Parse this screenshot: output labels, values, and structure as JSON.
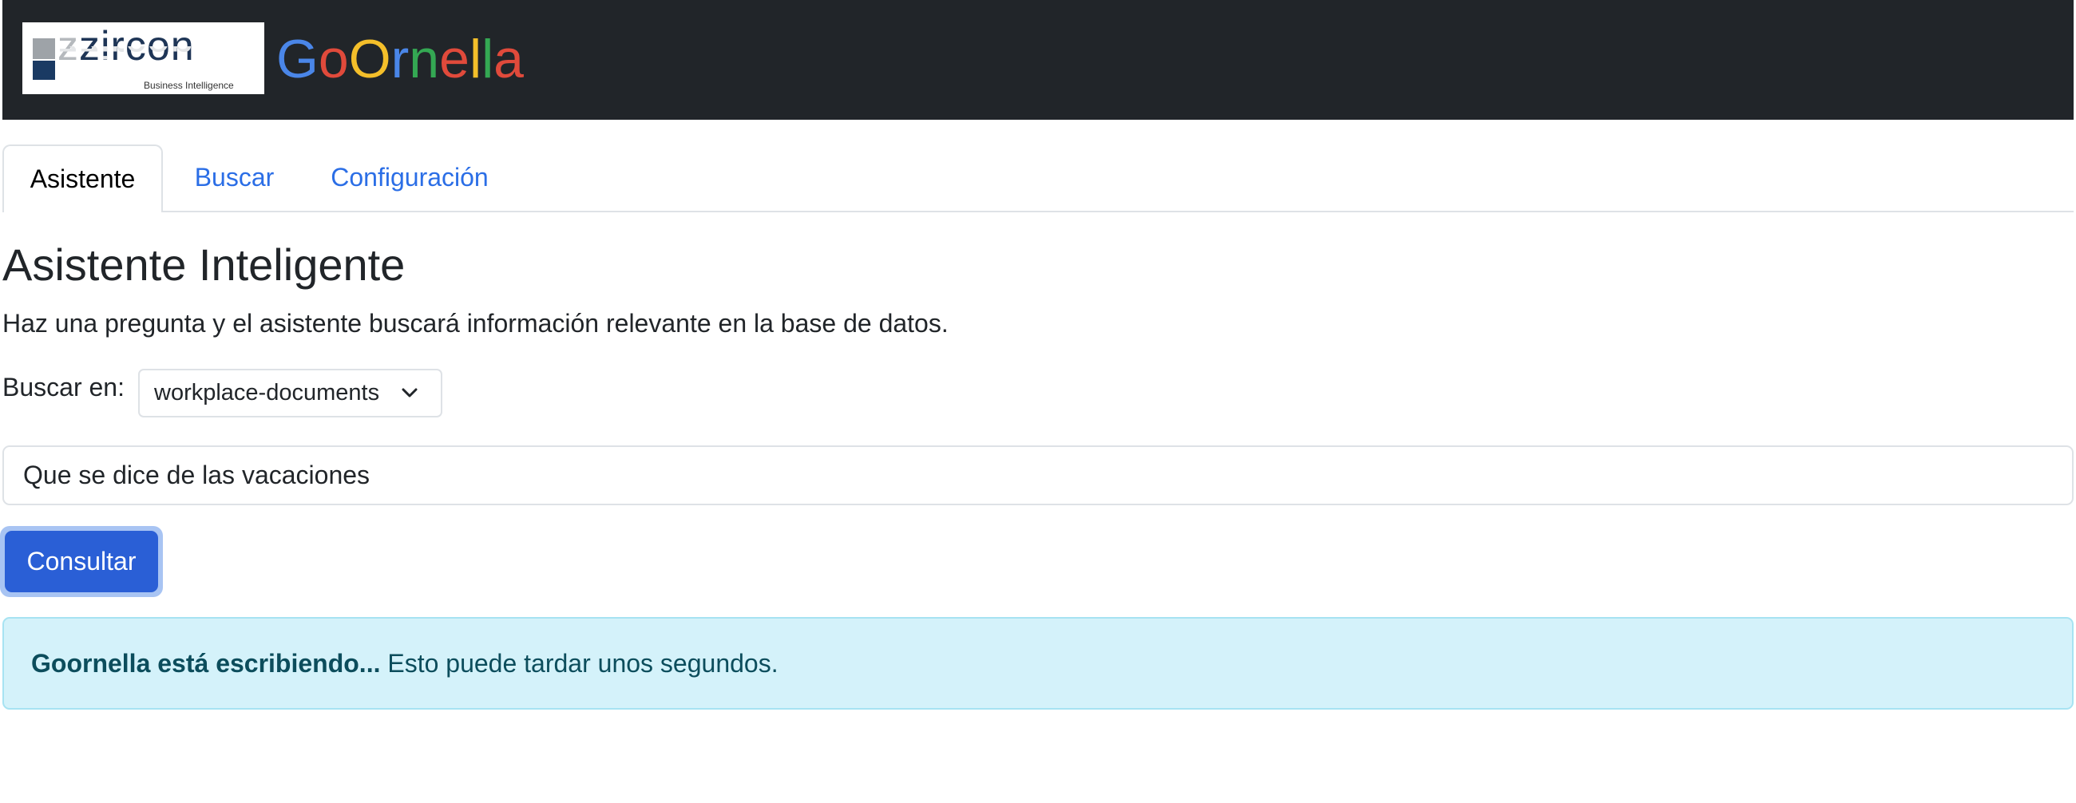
{
  "header": {
    "logo": {
      "wordmark": "zzircon",
      "tagline": "Business Intelligence"
    },
    "brand": {
      "text": "GoOrnella",
      "letters": [
        {
          "char": "G",
          "color": "#4a86e8"
        },
        {
          "char": "o",
          "color": "#e04a3b"
        },
        {
          "char": "O",
          "color": "#f4bf2a"
        },
        {
          "char": "r",
          "color": "#4a86e8"
        },
        {
          "char": "n",
          "color": "#34a853"
        },
        {
          "char": "e",
          "color": "#e04a3b"
        },
        {
          "char": "l",
          "color": "#f4bf2a"
        },
        {
          "char": "l",
          "color": "#34a853"
        },
        {
          "char": "a",
          "color": "#e04a3b"
        }
      ]
    }
  },
  "tabs": [
    {
      "label": "Asistente",
      "active": true
    },
    {
      "label": "Buscar",
      "active": false
    },
    {
      "label": "Configuración",
      "active": false
    }
  ],
  "main": {
    "title": "Asistente Inteligente",
    "subtitle": "Haz una pregunta y el asistente buscará información relevante en la base de datos.",
    "select_label": "Buscar en:",
    "select_value": "workplace-documents",
    "query_value": "Que se dice de las vacaciones",
    "submit_label": "Consultar"
  },
  "alert": {
    "bold": "Goornella está escribiendo...",
    "text": "Esto puede tardar unos segundos."
  },
  "colors": {
    "header_bg": "#212529",
    "link": "#2b6ee6",
    "primary_button": "#2a5fd6",
    "alert_bg": "#d4f2fa",
    "alert_text": "#0c4d5c"
  }
}
